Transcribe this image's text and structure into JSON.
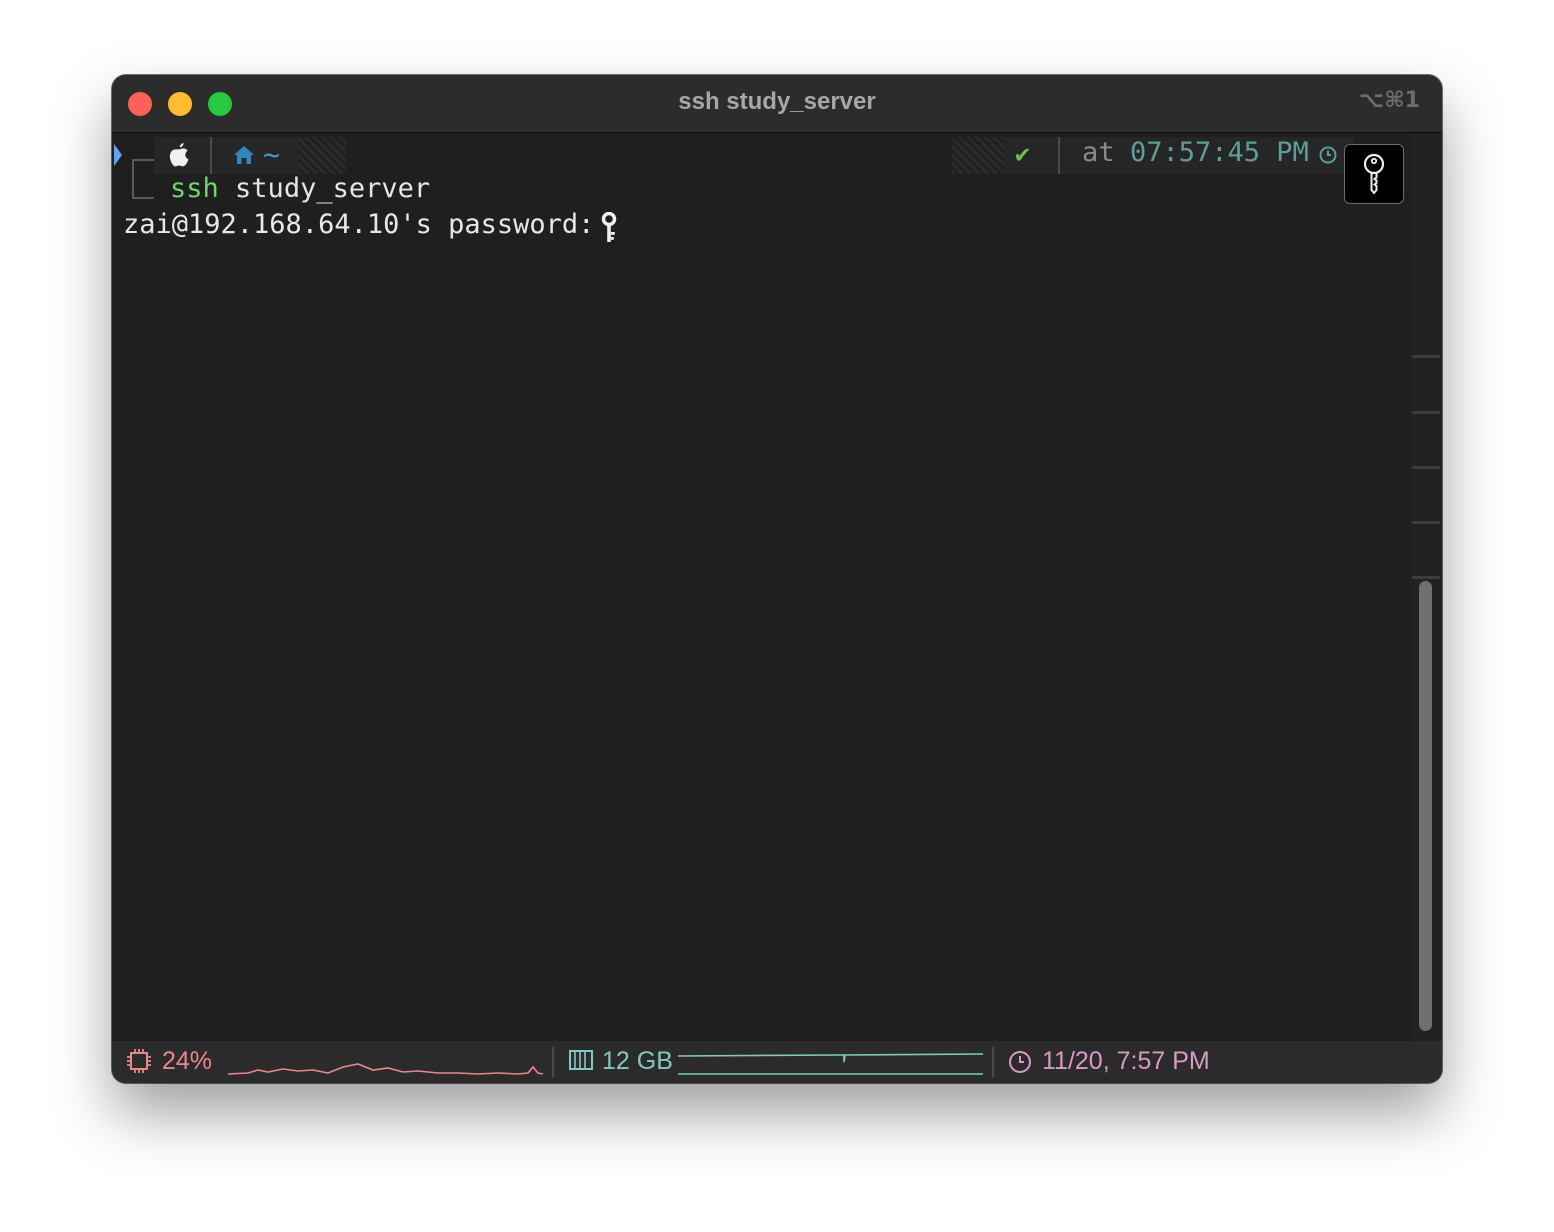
{
  "window": {
    "title": "ssh study_server",
    "shortcut": "⌥⌘1"
  },
  "prompt": {
    "os_icon": "apple-icon",
    "dir_icon": "home-icon",
    "dir": "~",
    "status_symbol": "✔",
    "time_prefix": "at",
    "time": "07:57:45 PM",
    "time_icon": "clock-icon"
  },
  "terminal": {
    "command": "ssh",
    "argument": "study_server",
    "password_prompt": "zai@192.168.64.10's password: ",
    "cursor_icon": "key-icon",
    "badge_icon": "key-icon"
  },
  "status": {
    "cpu_icon": "cpu-icon",
    "cpu": "24%",
    "memory_icon": "memory-icon",
    "memory": "12 GB",
    "clock_icon": "clock-icon",
    "datetime": "11/20, 7:57 PM"
  },
  "colors": {
    "cpu": "#e8888c",
    "memory": "#83c9c0",
    "clock": "#d99ac6",
    "command": "#6fd66a",
    "time": "#5e9e9a"
  }
}
